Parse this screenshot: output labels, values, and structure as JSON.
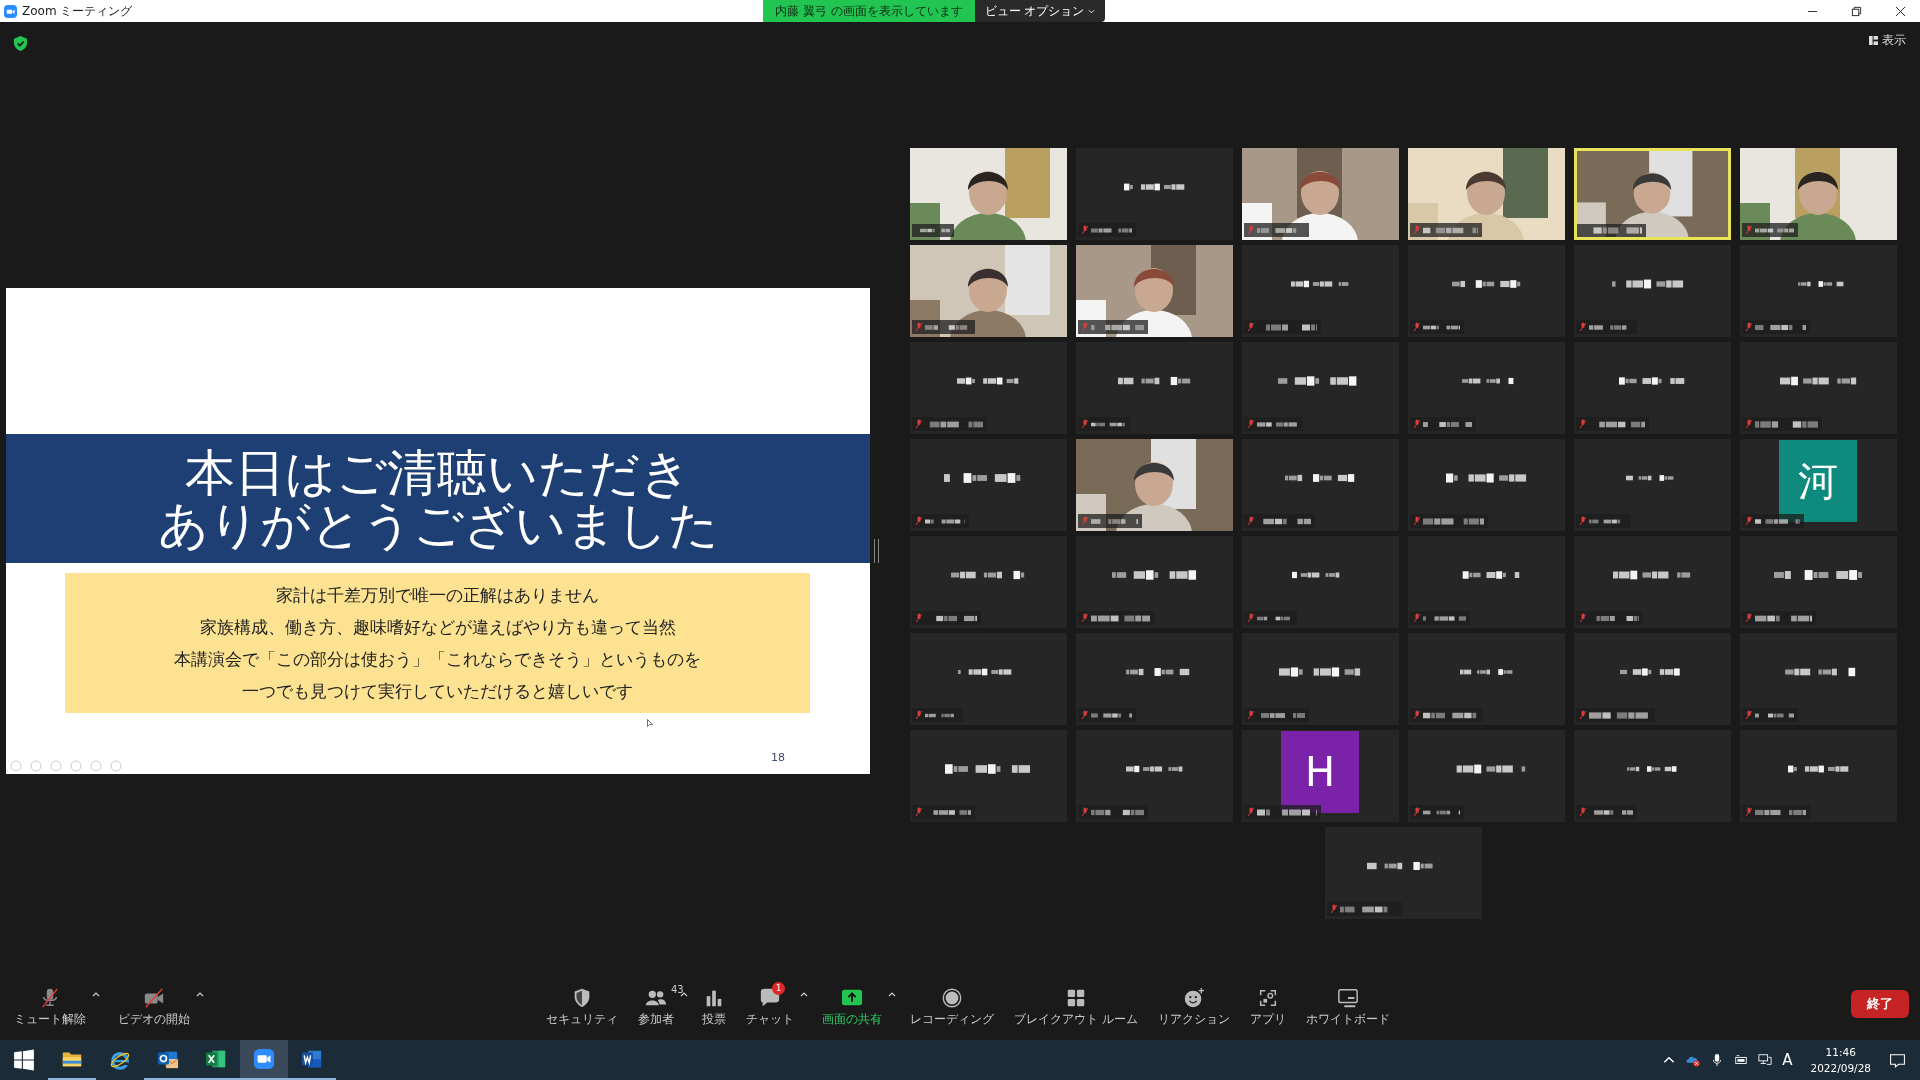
{
  "window": {
    "title": "Zoom ミーティング"
  },
  "share_banner": {
    "text": "内藤 翼弓 の画面を表示しています",
    "view_options": "ビュー オプション"
  },
  "view_toggle": "表示",
  "slide": {
    "title_lines": [
      "本日はご清聴いただき",
      "ありがとうございました"
    ],
    "body_lines": [
      "家計は千差万別で唯一の正解はありません",
      "家族構成、働き方、趣味嗜好などが違えばやり方も違って当然",
      "本講演会で「この部分は使おう」「これならできそう」というものを",
      "一つでも見つけて実行していただけると嬉しいです"
    ],
    "page": "18"
  },
  "gallery": [
    {
      "kind": "video",
      "muted": false,
      "speaking": false
    },
    {
      "kind": "name",
      "muted": true,
      "speaking": false
    },
    {
      "kind": "video",
      "muted": true,
      "speaking": false
    },
    {
      "kind": "video",
      "muted": true,
      "speaking": false
    },
    {
      "kind": "video",
      "muted": false,
      "speaking": true
    },
    {
      "kind": "video",
      "muted": true,
      "speaking": false
    },
    {
      "kind": "video",
      "muted": true,
      "speaking": false
    },
    {
      "kind": "video",
      "muted": true,
      "speaking": false
    },
    {
      "kind": "name",
      "muted": true,
      "speaking": false
    },
    {
      "kind": "name",
      "muted": true,
      "speaking": false
    },
    {
      "kind": "name",
      "muted": true,
      "speaking": false
    },
    {
      "kind": "name",
      "muted": true,
      "speaking": false
    },
    {
      "kind": "name",
      "muted": true,
      "speaking": false
    },
    {
      "kind": "name",
      "muted": true,
      "speaking": false
    },
    {
      "kind": "name",
      "muted": true,
      "speaking": false
    },
    {
      "kind": "name",
      "muted": true,
      "speaking": false
    },
    {
      "kind": "name",
      "muted": true,
      "speaking": false
    },
    {
      "kind": "name",
      "muted": true,
      "speaking": false
    },
    {
      "kind": "name",
      "muted": true,
      "speaking": false
    },
    {
      "kind": "video",
      "muted": true,
      "speaking": false
    },
    {
      "kind": "name",
      "muted": true,
      "speaking": false
    },
    {
      "kind": "name",
      "muted": true,
      "speaking": false
    },
    {
      "kind": "name",
      "muted": true,
      "speaking": false
    },
    {
      "kind": "avatar",
      "muted": true,
      "speaking": false,
      "avatar": "河",
      "color": "#0f8a7e"
    },
    {
      "kind": "name",
      "muted": true,
      "speaking": false
    },
    {
      "kind": "name",
      "muted": true,
      "speaking": false
    },
    {
      "kind": "name",
      "muted": true,
      "speaking": false
    },
    {
      "kind": "name",
      "muted": true,
      "speaking": false
    },
    {
      "kind": "name",
      "muted": true,
      "speaking": false
    },
    {
      "kind": "name",
      "muted": true,
      "speaking": false
    },
    {
      "kind": "name",
      "muted": true,
      "speaking": false
    },
    {
      "kind": "name",
      "muted": true,
      "speaking": false
    },
    {
      "kind": "name",
      "muted": true,
      "speaking": false
    },
    {
      "kind": "name",
      "muted": true,
      "speaking": false
    },
    {
      "kind": "name",
      "muted": true,
      "speaking": false
    },
    {
      "kind": "name",
      "muted": true,
      "speaking": false
    },
    {
      "kind": "name",
      "muted": true,
      "speaking": false
    },
    {
      "kind": "name",
      "muted": true,
      "speaking": false
    },
    {
      "kind": "avatar",
      "muted": true,
      "speaking": false,
      "avatar": "H",
      "color": "#7a22a8"
    },
    {
      "kind": "name",
      "muted": true,
      "speaking": false
    },
    {
      "kind": "name",
      "muted": true,
      "speaking": false
    },
    {
      "kind": "name",
      "muted": true,
      "speaking": false
    },
    {
      "kind": "name",
      "muted": true,
      "speaking": false
    }
  ],
  "toolbar": {
    "left": [
      {
        "kind": "mic",
        "label": "ミュート解除",
        "menu": true
      },
      {
        "kind": "video",
        "label": "ビデオの開始",
        "menu": true
      }
    ],
    "center": [
      {
        "kind": "security",
        "label": "セキュリティ",
        "menu": false
      },
      {
        "kind": "participants",
        "label": "参加者",
        "count": "43",
        "menu": true
      },
      {
        "kind": "polls",
        "label": "投票",
        "menu": false
      },
      {
        "kind": "chat",
        "label": "チャット",
        "badge": "1",
        "menu": true
      },
      {
        "kind": "share",
        "label": "画面の共有",
        "menu": true
      },
      {
        "kind": "record",
        "label": "レコーディング",
        "menu": false
      },
      {
        "kind": "breakout",
        "label": "ブレイクアウト ルーム",
        "menu": false
      },
      {
        "kind": "reactions",
        "label": "リアクション",
        "menu": false
      },
      {
        "kind": "apps",
        "label": "アプリ",
        "menu": false
      },
      {
        "kind": "whiteboard",
        "label": "ホワイトボード",
        "menu": false
      }
    ],
    "end": "終了"
  },
  "taskbar": {
    "apps": [
      {
        "kind": "start",
        "running": false,
        "active": false
      },
      {
        "kind": "explorer",
        "running": true,
        "active": false
      },
      {
        "kind": "ie",
        "running": false,
        "active": false
      },
      {
        "kind": "outlook",
        "running": true,
        "active": false
      },
      {
        "kind": "excel",
        "running": true,
        "active": false
      },
      {
        "kind": "zoom",
        "running": true,
        "active": true
      },
      {
        "kind": "word",
        "running": true,
        "active": false
      }
    ],
    "ime": "A",
    "time": "11:46",
    "date": "2022/09/28"
  }
}
